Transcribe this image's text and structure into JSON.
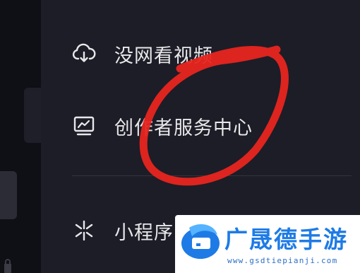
{
  "menu": {
    "items": [
      {
        "label": "没网看视频",
        "icon": "cloud-download-icon"
      },
      {
        "label": "创作者服务中心",
        "icon": "creator-chart-icon"
      },
      {
        "label": "小程序",
        "icon": "mini-program-icon"
      }
    ]
  },
  "annotation": {
    "color": "#e8251f",
    "shape": "hand-drawn-circle"
  },
  "watermark": {
    "title": "广晟德手游",
    "url": "www.gsdtiepianji.com",
    "logo": "gsd-logo-icon",
    "brand_color": "#1e7be6"
  },
  "colors": {
    "background": "#161823",
    "panel": "#1c1d27",
    "text": "#e8e8ea"
  }
}
